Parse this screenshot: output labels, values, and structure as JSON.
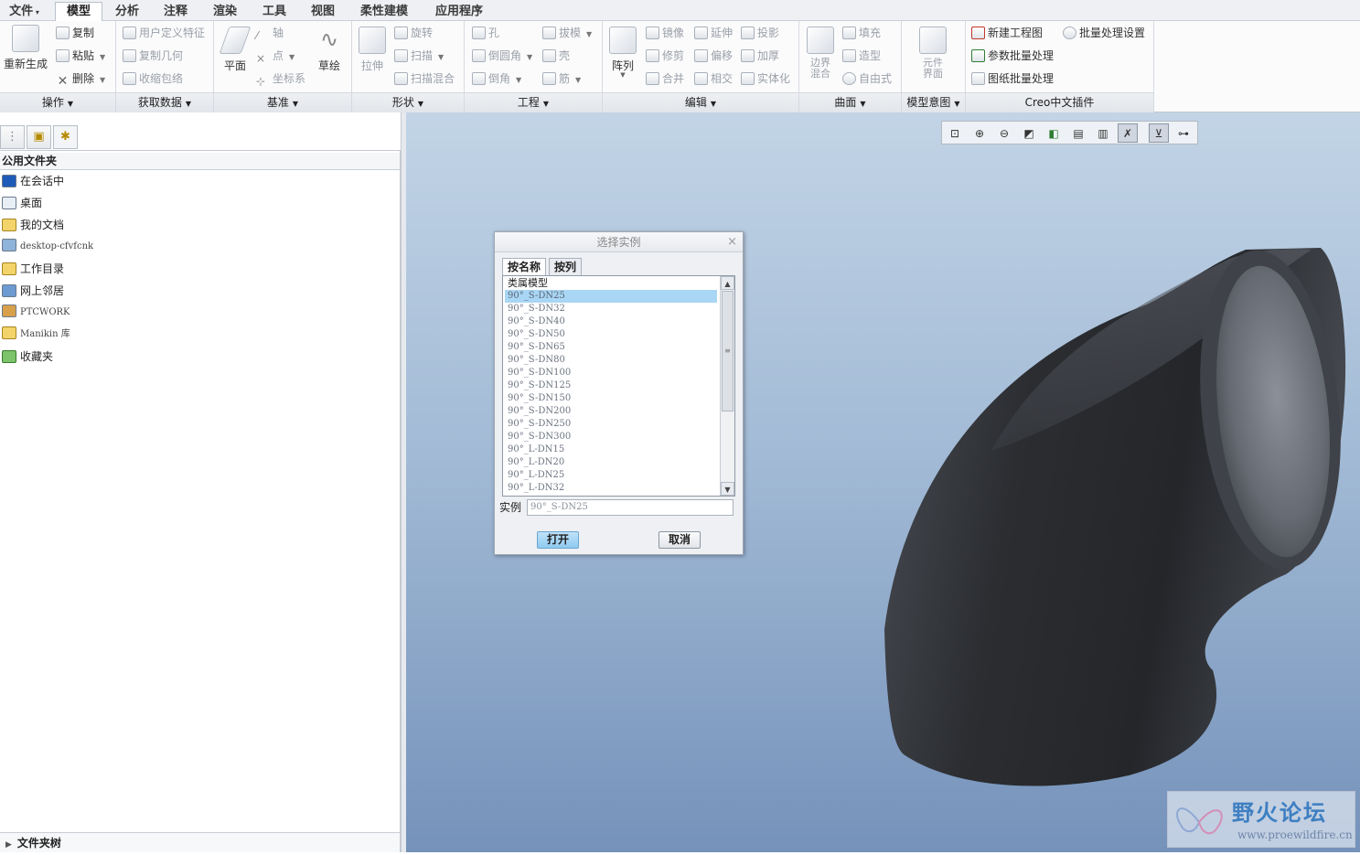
{
  "menubar": {
    "file": "文件",
    "tabs": [
      "模型",
      "分析",
      "注释",
      "渲染",
      "工具",
      "视图",
      "柔性建模",
      "应用程序"
    ],
    "active_tab": "模型"
  },
  "ribbon": {
    "groups": {
      "operation": {
        "label": "操作",
        "regen": "重新生成",
        "copy": "复制",
        "paste": "粘贴",
        "delete": "删除"
      },
      "get_data": {
        "label": "获取数据",
        "udf": "用户定义特征",
        "copy_geom": "复制几何",
        "shrinkwrap": "收缩包络"
      },
      "datum": {
        "label": "基准",
        "plane": "平面",
        "axis": "轴",
        "point": "点",
        "csys": "坐标系",
        "sketch": "草绘"
      },
      "shape": {
        "label": "形状",
        "extrude": "拉伸",
        "revolve": "旋转",
        "sweep": "扫描",
        "swept_blend": "扫描混合"
      },
      "engineering": {
        "label": "工程",
        "hole": "孔",
        "round": "倒圆角",
        "chamfer": "倒角",
        "draft": "拔模",
        "shell": "壳",
        "rib": "筋"
      },
      "editing": {
        "label": "编辑",
        "pattern": "阵列",
        "mirror": "镜像",
        "extend": "延伸",
        "project": "投影",
        "trim": "修剪",
        "offset": "偏移",
        "thicken": "加厚",
        "merge": "合并",
        "intersect": "相交",
        "solidify": "实体化"
      },
      "surfaces": {
        "label": "曲面",
        "boundary_blend": "边界混合",
        "fill": "填充",
        "style": "造型",
        "freestyle": "自由式"
      },
      "model_intent": {
        "label": "模型意图",
        "component_interface": "元件界面"
      },
      "creo_plugin": {
        "label": "Creo中文插件",
        "new_drawing": "新建工程图",
        "batch_settings": "批量处理设置",
        "param_batch": "参数批量处理",
        "drawing_batch": "图纸批量处理"
      }
    }
  },
  "navigator": {
    "header": "公用文件夹",
    "folders": [
      "在会话中",
      "桌面",
      "我的文档",
      "desktop-cfvfcnk",
      "工作目录",
      "网上邻居",
      "PTCWORK",
      "Manikin 库",
      "收藏夹"
    ],
    "footer": "文件夹树"
  },
  "dialog": {
    "title": "选择实例",
    "close": "×",
    "tabs": [
      "按名称",
      "按列"
    ],
    "list_header": "类属模型",
    "items": [
      "90°_S-DN25",
      "90°_S-DN32",
      "90°_S-DN40",
      "90°_S-DN50",
      "90°_S-DN65",
      "90°_S-DN80",
      "90°_S-DN100",
      "90°_S-DN125",
      "90°_S-DN150",
      "90°_S-DN200",
      "90°_S-DN250",
      "90°_S-DN300",
      "90°_L-DN15",
      "90°_L-DN20",
      "90°_L-DN25",
      "90°_L-DN32"
    ],
    "selected": "90°_S-DN25",
    "instance_label": "实例",
    "instance_value": "90°_S-DN25",
    "open": "打开",
    "cancel": "取消"
  },
  "watermark": {
    "title": "野火论坛",
    "url": "www.proewildfire.cn"
  },
  "colors": {
    "accent": "#a9d6f5",
    "viewport_top": "#c2d4e6",
    "viewport_bottom": "#7592ba",
    "model": "#3a3d42"
  }
}
